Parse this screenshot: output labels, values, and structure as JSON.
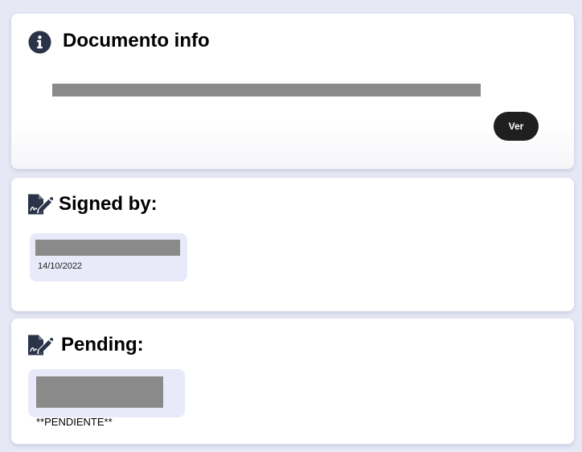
{
  "document_card": {
    "title": "Documento info",
    "icon": "info-icon",
    "view_button_label": "Ver"
  },
  "signed_card": {
    "title": "Signed by:",
    "icon": "signature-icon",
    "signers": [
      {
        "date": "14/10/2022"
      }
    ]
  },
  "pending_card": {
    "title": "Pending:",
    "icon": "signature-icon",
    "status": "**PENDIENTE**"
  },
  "colors": {
    "background": "#e6e8f5",
    "card": "#ffffff",
    "chip": "#e8eaf9",
    "button": "#1f1f1f",
    "icon": "#2a3347",
    "redaction": "#8a8a8a"
  }
}
